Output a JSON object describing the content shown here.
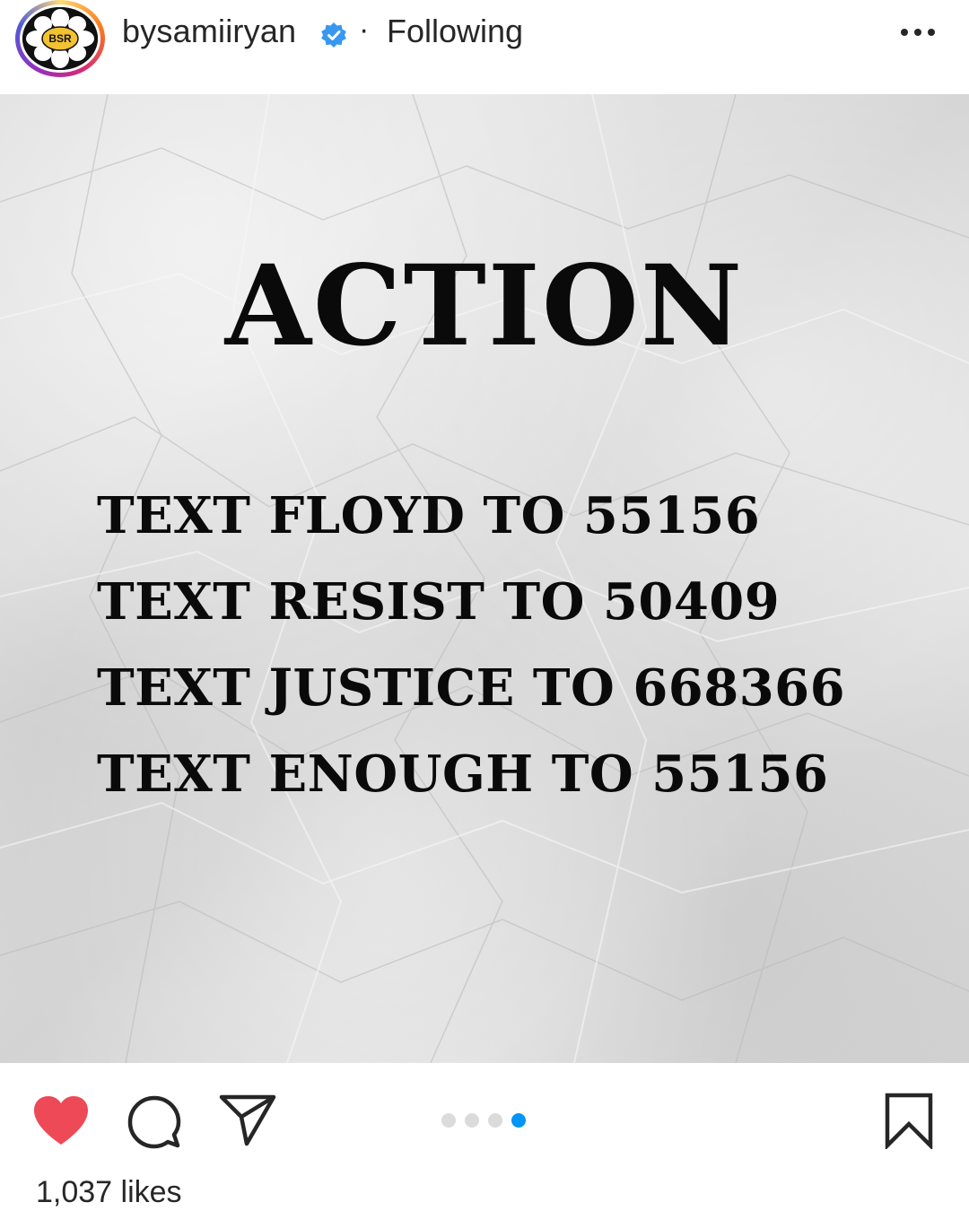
{
  "header": {
    "avatar_text": "BSR",
    "username": "bysamiiryan",
    "separator": "·",
    "follow_status": "Following",
    "more_icon": "more-horizontal-icon",
    "verified_color": "#3897f0"
  },
  "post": {
    "title": "ACTION",
    "lines": [
      "TEXT FLOYD TO 55156",
      "TEXT RESIST TO 50409",
      "TEXT JUSTICE TO 668366",
      "TEXT ENOUGH TO 55156"
    ],
    "carousel": {
      "total": 4,
      "active_index": 3
    }
  },
  "actions": {
    "like_icon": "heart-icon",
    "comment_icon": "comment-icon",
    "share_icon": "share-icon",
    "save_icon": "bookmark-icon",
    "liked": true,
    "like_color": "#ed4956"
  },
  "likes_text": "1,037 likes"
}
